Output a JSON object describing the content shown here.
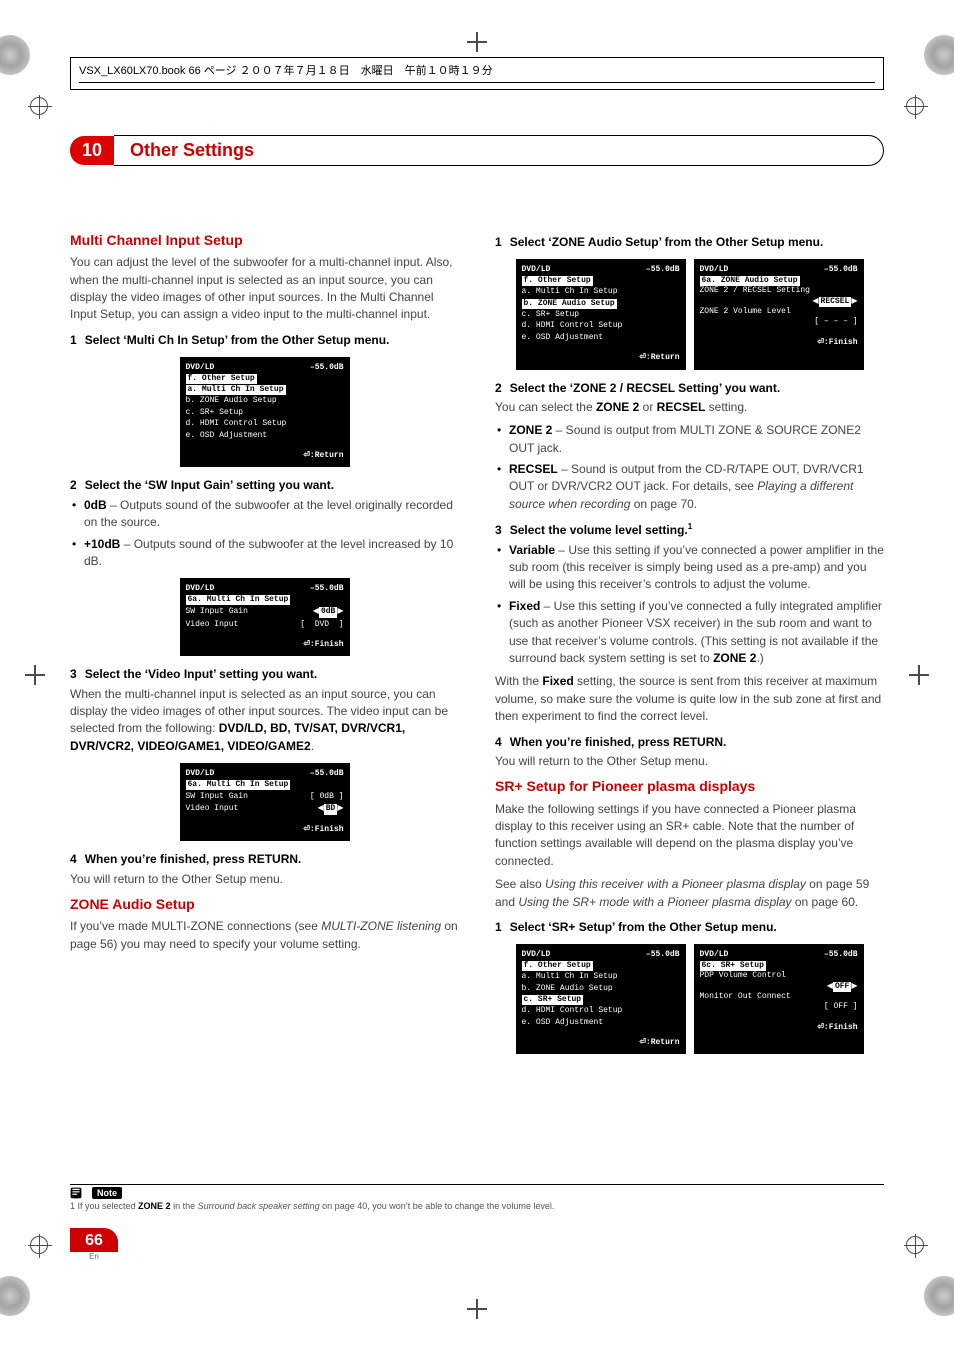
{
  "book_header": "VSX_LX60LX70.book 66 ページ ２００７年７月１８日　水曜日　午前１０時１９分",
  "chapter": {
    "num": "10",
    "title": "Other Settings"
  },
  "left": {
    "h_multi": "Multi Channel Input Setup",
    "p_multi": "You can adjust the level of the subwoofer for a multi-channel input. Also, when the multi-channel input is selected as an input source, you can display the video images of other input sources. In the Multi Channel Input Setup, you can assign a video input to the multi-channel input.",
    "s1_num": "1",
    "s1": "Select ‘Multi Ch In Setup’ from the Other Setup menu.",
    "s2_num": "2",
    "s2": "Select the ‘SW Input Gain’ setting you want.",
    "b1_label": "0dB",
    "b1_text": " – Outputs sound of the subwoofer at the level originally recorded on the source.",
    "b2_label": "+10dB",
    "b2_text": " – Outputs sound of the subwoofer at the level increased by 10 dB.",
    "s3_num": "3",
    "s3": "Select the ‘Video Input’ setting you want.",
    "p_video_a": "When the multi-channel input is selected as an input source, you can display the video images of other input sources. The video input can be selected from the following: ",
    "p_video_list": "DVD/LD, BD, TV/SAT, DVR/VCR1, DVR/VCR2, VIDEO/GAME1, VIDEO/GAME2",
    "p_video_end": ".",
    "s4_num": "4",
    "s4": "When you’re finished, press RETURN.",
    "p_return": "You will return to the Other Setup menu.",
    "h_zone": "ZONE Audio Setup",
    "p_zone_a": "If you’ve made MULTI-ZONE connections (see ",
    "p_zone_em": "MULTI-ZONE listening",
    "p_zone_b": " on page 56) you may need to specify your volume setting."
  },
  "right": {
    "s1_num": "1",
    "s1": "Select ‘ZONE Audio Setup’ from the Other Setup menu.",
    "s2_num": "2",
    "s2": "Select the ‘ZONE 2 / RECSEL Setting’ you want.",
    "p_sel_a": "You can select the ",
    "p_sel_b": "ZONE 2",
    "p_sel_c": " or ",
    "p_sel_d": "RECSEL",
    "p_sel_e": " setting.",
    "b_zone2_label": "ZONE 2",
    "b_zone2_text": " – Sound is output from MULTI ZONE & SOURCE ZONE2 OUT jack.",
    "b_recsel_label": "RECSEL",
    "b_recsel_text_a": " – Sound is output from the CD-R/TAPE OUT, DVR/VCR1 OUT or DVR/VCR2 OUT jack. For details, see ",
    "b_recsel_em": "Playing a different source when recording",
    "b_recsel_text_b": " on page 70.",
    "s3_num": "3",
    "s3": "Select the volume level setting.",
    "s3_sup": "1",
    "b_var_label": "Variable",
    "b_var_text": " – Use this setting if you’ve connected a power amplifier in the sub room (this receiver is simply being used as a pre-amp) and you will be using this receiver’s controls to adjust the volume.",
    "b_fix_label": "Fixed",
    "b_fix_text_a": " – Use this setting if you’ve connected a fully integrated amplifier (such as another Pioneer VSX receiver) in the sub room and want to use that receiver’s volume controls. (This setting is not available if the surround back system setting is set to ",
    "b_fix_bold": "ZONE 2",
    "b_fix_text_b": ".)",
    "p_fixed_a": "With the ",
    "p_fixed_bold": "Fixed",
    "p_fixed_b": " setting, the source is sent from this receiver at maximum volume, so make sure the volume is quite low in the sub zone at first and then experiment to find the correct level.",
    "s4_num": "4",
    "s4": "When you’re finished, press RETURN.",
    "p_return": "You will return to the Other Setup menu.",
    "h_sr": "SR+ Setup for Pioneer plasma displays",
    "p_sr": "Make the following settings if you have connected a Pioneer plasma display to this receiver using an SR+ cable. Note that the number of function settings available will depend on the plasma display you’ve connected.",
    "p_sr2_a": "See also ",
    "p_sr2_em1": "Using this receiver with a Pioneer plasma display",
    "p_sr2_b": " on page 59 and ",
    "p_sr2_em2": "Using the SR+ mode with a Pioneer plasma display",
    "p_sr2_c": " on page 60.",
    "s_sr1_num": "1",
    "s_sr1": "Select ‘SR+ Setup’ from the Other Setup menu."
  },
  "osd": {
    "hdr_src": "DVD/LD",
    "hdr_db": "–55.0dB",
    "foot_return": "⏎:Return",
    "foot_finish": "⏎:Finish",
    "other_title": "f. Other Setup",
    "other_items": [
      "a. Multi Ch In Setup",
      "b. ZONE Audio Setup",
      "c. SR+ Setup",
      "d. HDMI Control Setup",
      "e. OSD Adjustment"
    ],
    "mc_title": "6a. Multi Ch In Setup",
    "mc_sw": "SW Input Gain",
    "mc_sw_val0": "0dB",
    "mc_vi": "Video Input",
    "mc_vi_val": "DVD",
    "mc_sw_idle": "[  0dB ]",
    "mc_vi_bd": "BD",
    "zone_title": "6a. ZONE Audio Setup",
    "zone_line1": "ZONE 2 / RECSEL Setting",
    "zone_val": "RECSEL",
    "zone_line2": "ZONE 2 Volume Level",
    "zone_val2": "[   – – –   ]",
    "sr_title": "6c. SR+ Setup",
    "sr_line1": "PDP Volume Control",
    "sr_val1": "OFF",
    "sr_line2": "Monitor Out Connect",
    "sr_val2": "[    OFF    ]"
  },
  "footnote": {
    "label": "Note",
    "text_a": "1 If you selected ",
    "bold": "ZONE 2",
    "text_b": " in the ",
    "em": "Surround back speaker setting",
    "text_c": " on page 40, you won’t be able to change the volume level."
  },
  "pagenum": {
    "num": "66",
    "lang": "En"
  }
}
